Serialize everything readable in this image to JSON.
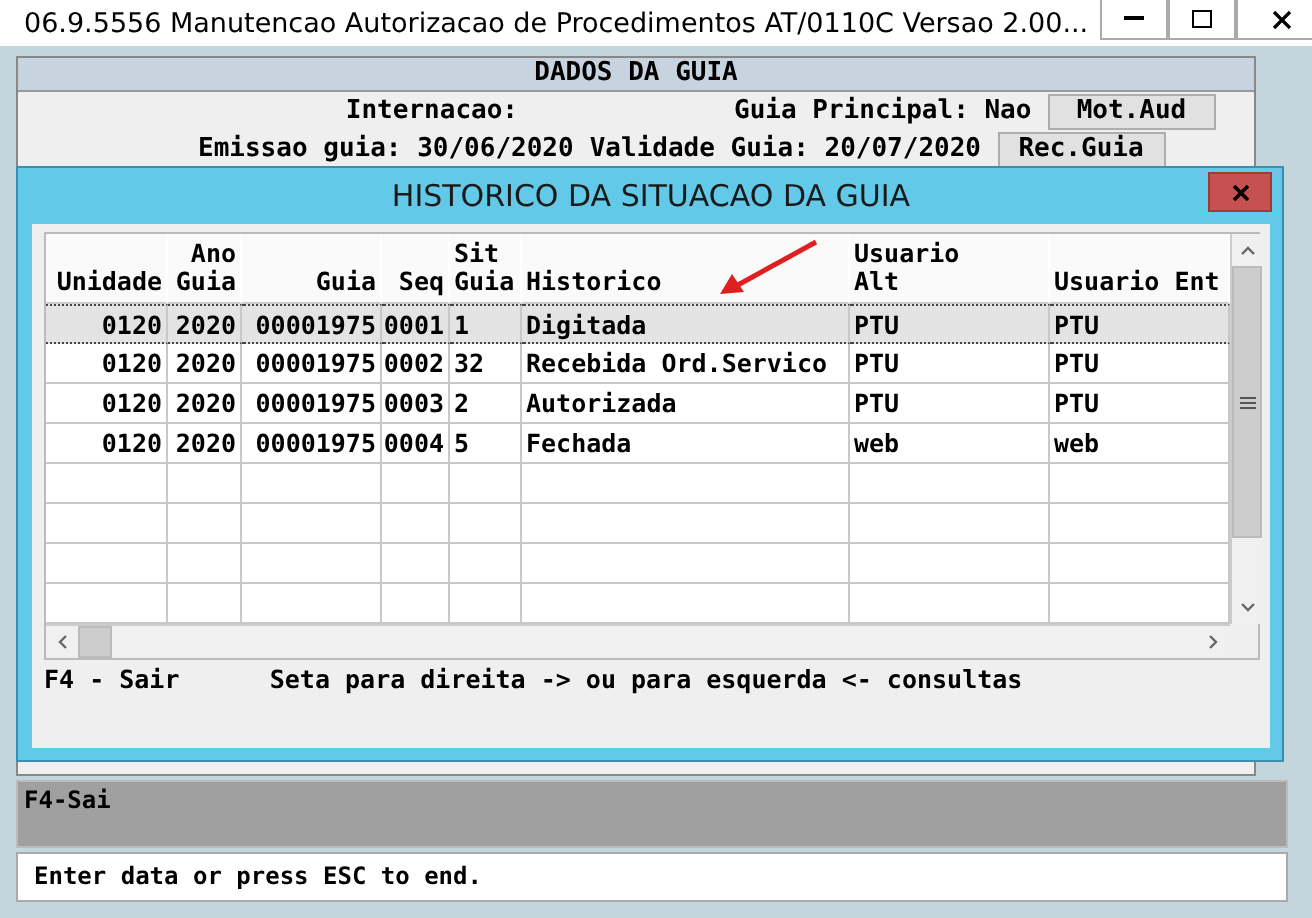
{
  "window": {
    "title": "06.9.5556 Manutencao Autorizacao de Procedimentos AT/0110C Versao 2.00..."
  },
  "panel": {
    "header": "DADOS DA GUIA",
    "lines": [
      {
        "left": "Internacao:",
        "right": "Guia Principal: Nao",
        "button": "Mot.Aud"
      },
      {
        "left": "Emissao guia: 30/06/2020",
        "right": "Validade Guia: 20/07/2020",
        "button": "Rec.Guia"
      }
    ]
  },
  "dialog": {
    "title": "HISTORICO DA SITUACAO DA GUIA",
    "columns": [
      {
        "label": [
          "Unidade"
        ]
      },
      {
        "label": [
          "Ano",
          "Guia"
        ]
      },
      {
        "label": [
          "Guia"
        ]
      },
      {
        "label": [
          "Seq"
        ]
      },
      {
        "label": [
          "Sit",
          "Guia"
        ]
      },
      {
        "label": [
          "Historico"
        ]
      },
      {
        "label": [
          "Usuario",
          "Alt"
        ]
      },
      {
        "label": [
          "Usuario Ent"
        ]
      }
    ],
    "rows": [
      {
        "cells": [
          "0120",
          "2020",
          "00001975",
          "0001",
          "1",
          "Digitada",
          "PTU",
          "PTU"
        ],
        "selected": true
      },
      {
        "cells": [
          "0120",
          "2020",
          "00001975",
          "0002",
          "32",
          "Recebida Ord.Servico",
          "PTU",
          "PTU"
        ],
        "selected": false
      },
      {
        "cells": [
          "0120",
          "2020",
          "00001975",
          "0003",
          "2",
          "Autorizada",
          "PTU",
          "PTU"
        ],
        "selected": false
      },
      {
        "cells": [
          "0120",
          "2020",
          "00001975",
          "0004",
          "5",
          "Fechada",
          "web",
          "web"
        ],
        "selected": false
      }
    ],
    "footer": "F4 - Sair      Seta para direita -> ou para esquerda <- consultas"
  },
  "function_bar": "F4-Sai",
  "status_bar": "Enter data or press ESC to end."
}
